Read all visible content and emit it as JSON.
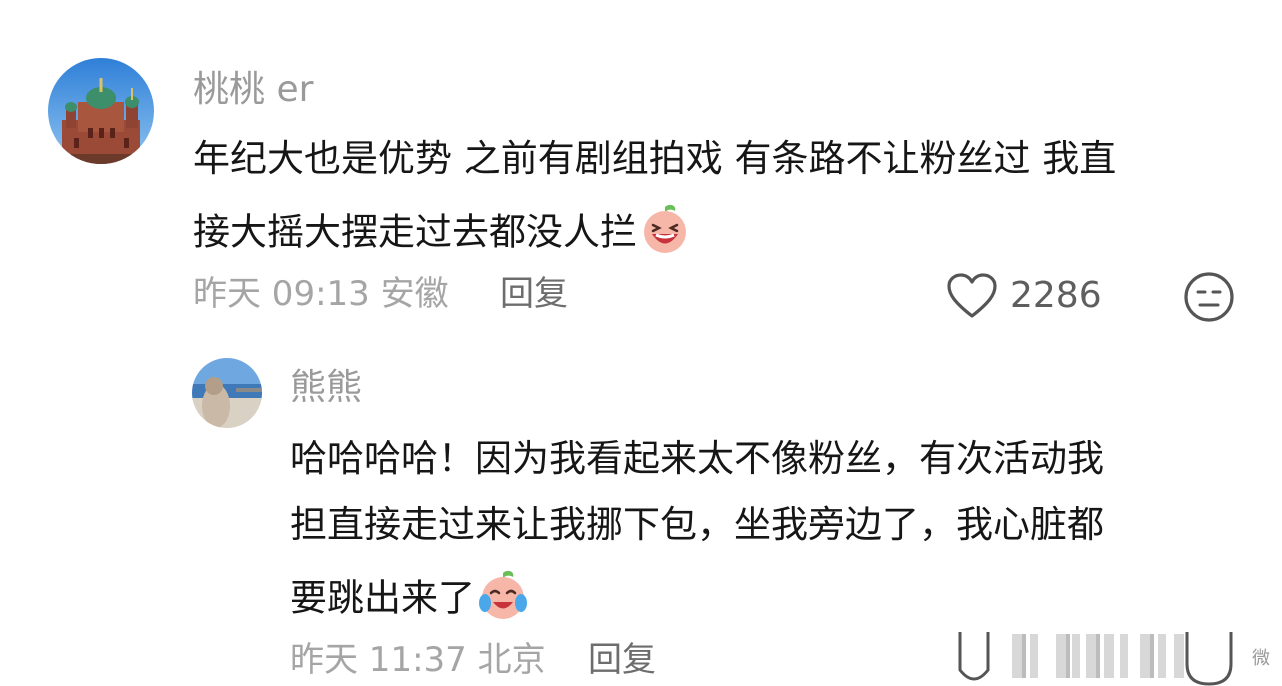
{
  "colors": {
    "username": "#9a9a9a",
    "text": "#161616",
    "meta": "#a5a5a5",
    "reply": "#6d6d6d",
    "icon": "#555555"
  },
  "comment": {
    "avatar_icon": "cathedral-photo",
    "username": "桃桃 er",
    "lines": [
      "年纪大也是优势 之前有剧组拍戏 有条路不让粉丝过 我直",
      "接大摇大摆走过去都没人拦"
    ],
    "emoji": "laughing-peach-emoji",
    "time": "昨天 09:13 安徽",
    "reply_label": "回复",
    "like_count": "2286",
    "like_icon": "heart-icon",
    "dislike_icon": "meh-face-icon"
  },
  "reply": {
    "avatar_icon": "lakeside-photo",
    "username": "熊熊",
    "lines": [
      "哈哈哈哈！因为我看起来太不像粉丝，有次活动我",
      "担直接走过来让我挪下包，坐我旁边了，我心脏都",
      "要跳出来了"
    ],
    "emoji": "crying-laughing-peach-emoji",
    "time": "昨天 11:37 北京",
    "reply_label": "回复"
  },
  "watermark": {
    "label": "微博"
  }
}
